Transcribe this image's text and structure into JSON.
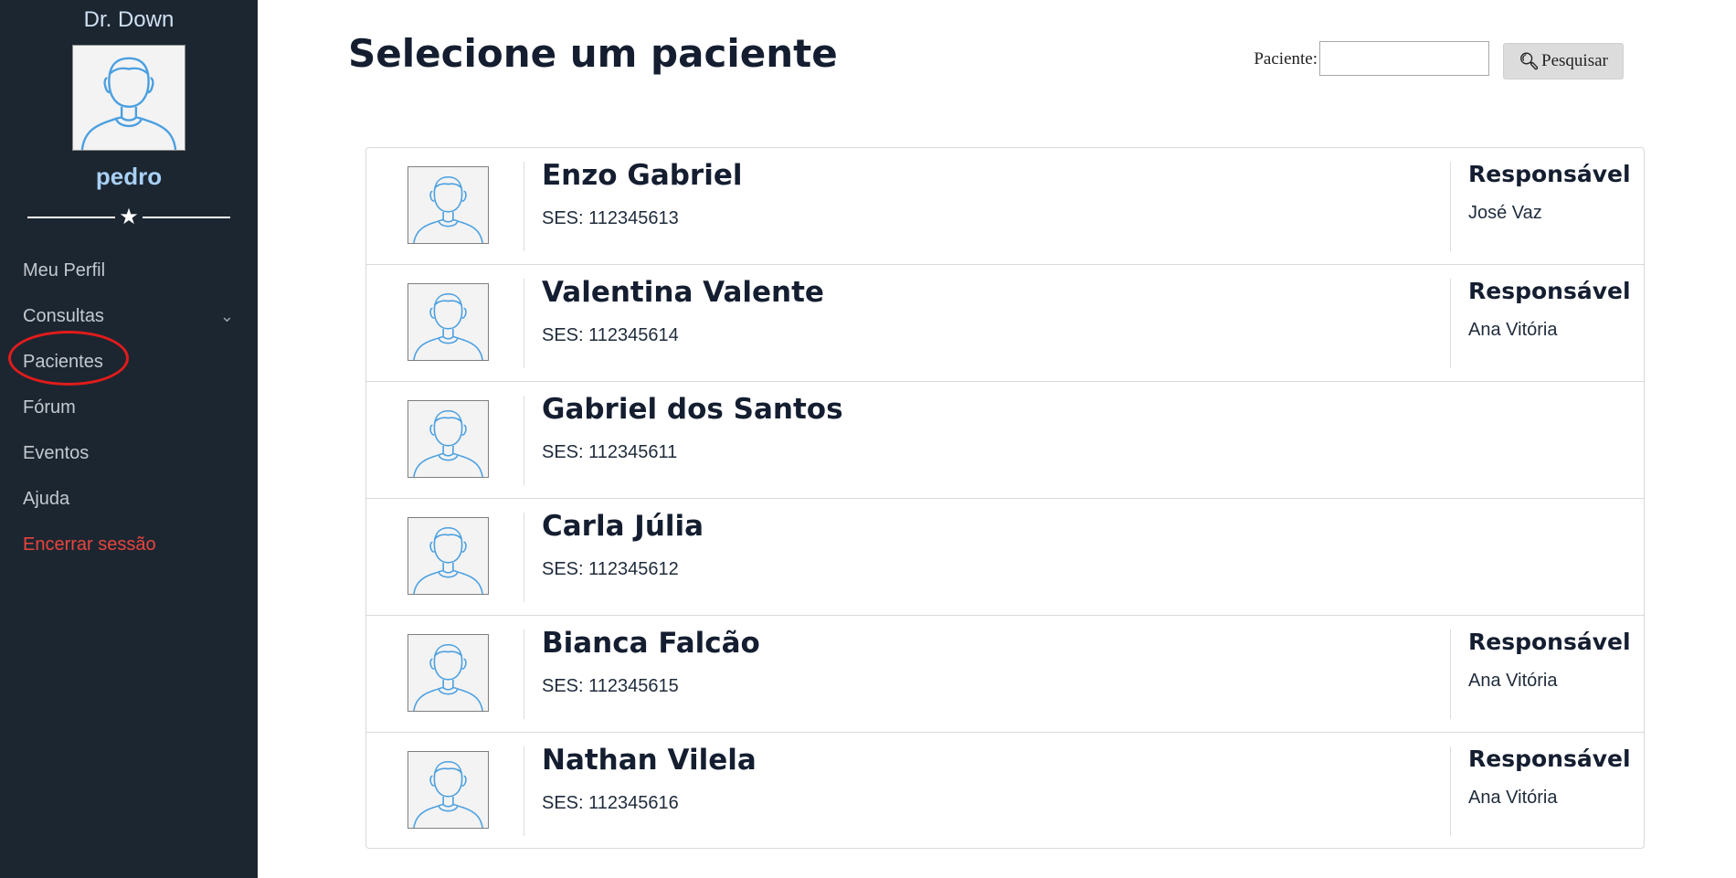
{
  "sidebar": {
    "brand": "Dr. Down",
    "username": "pedro",
    "items": [
      {
        "label": "Meu Perfil"
      },
      {
        "label": "Consultas"
      },
      {
        "label": "Pacientes"
      },
      {
        "label": "Fórum"
      },
      {
        "label": "Eventos"
      },
      {
        "label": "Ajuda"
      },
      {
        "label": "Encerrar sessão"
      }
    ]
  },
  "main": {
    "title": "Selecione um paciente",
    "search": {
      "label": "Paciente:",
      "value": "",
      "placeholder": "",
      "button_label": "Pesquisar"
    },
    "patients": [
      {
        "name": "Enzo Gabriel",
        "ses": "SES: 112345613",
        "resp_title": "Responsável",
        "resp_name": "José Vaz"
      },
      {
        "name": "Valentina Valente",
        "ses": "SES: 112345614",
        "resp_title": "Responsável",
        "resp_name": "Ana Vitória"
      },
      {
        "name": "Gabriel dos Santos",
        "ses": "SES: 112345611",
        "resp_title": "",
        "resp_name": ""
      },
      {
        "name": "Carla Júlia",
        "ses": "SES: 112345612",
        "resp_title": "",
        "resp_name": ""
      },
      {
        "name": "Bianca Falcão",
        "ses": "SES: 112345615",
        "resp_title": "Responsável",
        "resp_name": "Ana Vitória"
      },
      {
        "name": "Nathan Vilela",
        "ses": "SES: 112345616",
        "resp_title": "Responsável",
        "resp_name": "Ana Vitória"
      }
    ]
  },
  "icons": {
    "star": "star-icon",
    "chevron": "chevron-down-icon",
    "search": "search-icon",
    "avatar": "user-avatar-icon"
  },
  "colors": {
    "sidebar_bg": "#1c2631",
    "username": "#a9d0f5",
    "logout": "#e8453c",
    "highlight_circle": "#e21b1b",
    "title": "#141e30"
  }
}
